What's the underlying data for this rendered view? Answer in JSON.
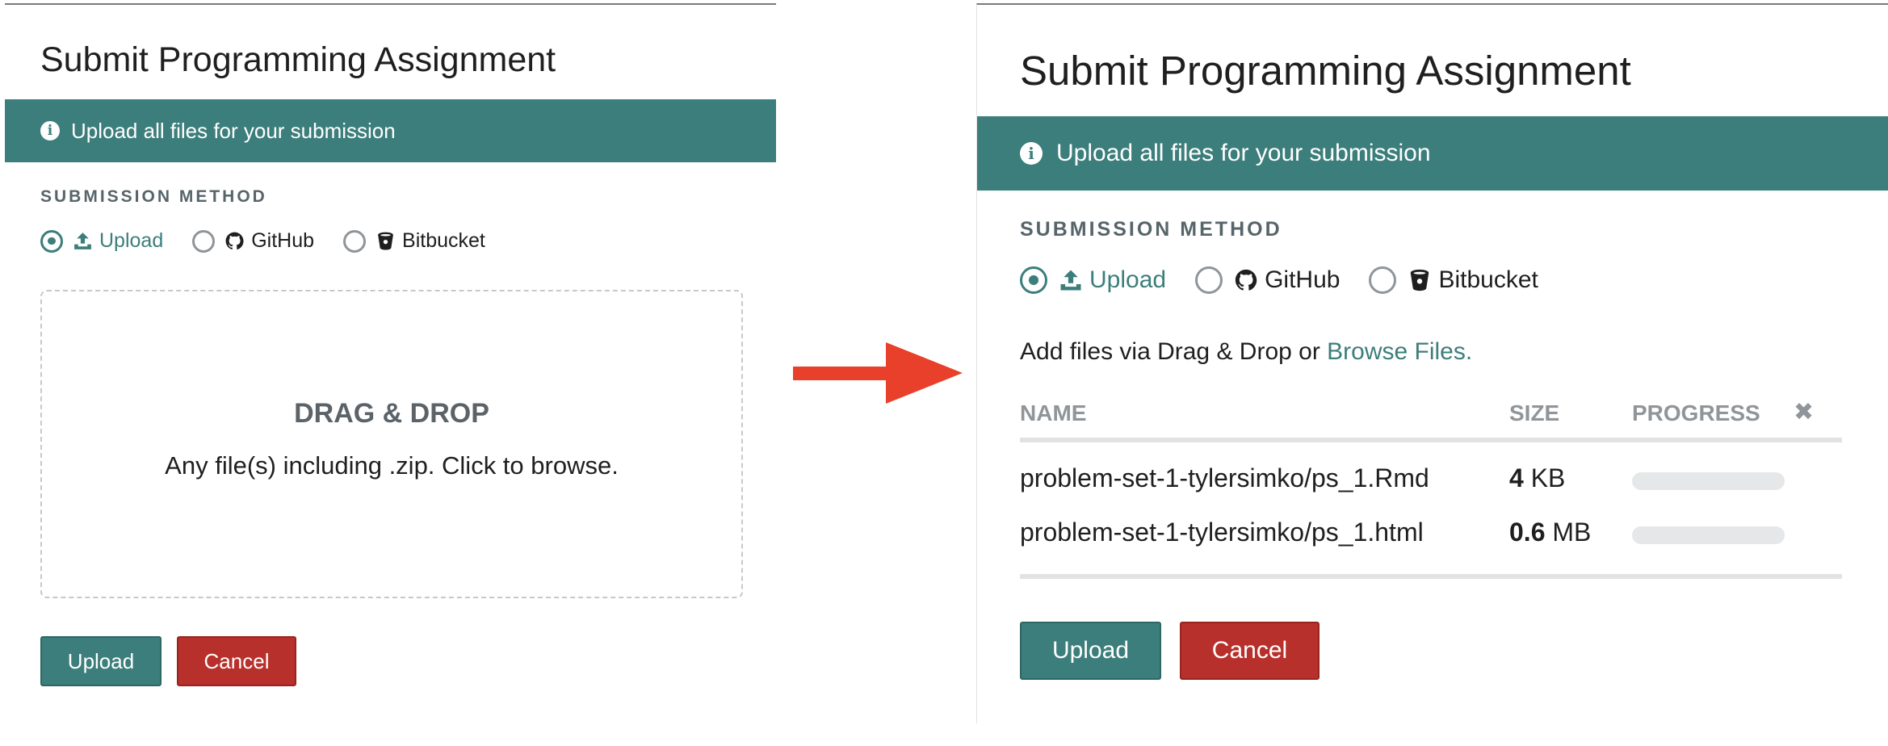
{
  "before": {
    "title": "Submit Programming Assignment",
    "banner_text": "Upload all files for your submission",
    "section_label": "SUBMISSION METHOD",
    "methods": [
      {
        "label": "Upload",
        "icon": "upload-icon",
        "selected": true
      },
      {
        "label": "GitHub",
        "icon": "github-icon",
        "selected": false
      },
      {
        "label": "Bitbucket",
        "icon": "bitbucket-icon",
        "selected": false
      }
    ],
    "dropzone": {
      "title": "DRAG & DROP",
      "subtitle": "Any file(s) including .zip. Click to browse."
    },
    "buttons": {
      "upload": "Upload",
      "cancel": "Cancel"
    }
  },
  "after": {
    "title": "Submit Programming Assignment",
    "banner_text": "Upload all files for your submission",
    "section_label": "SUBMISSION METHOD",
    "methods": [
      {
        "label": "Upload",
        "icon": "upload-icon",
        "selected": true
      },
      {
        "label": "GitHub",
        "icon": "github-icon",
        "selected": false
      },
      {
        "label": "Bitbucket",
        "icon": "bitbucket-icon",
        "selected": false
      }
    ],
    "add_files": {
      "text": "Add files via Drag & Drop or ",
      "link": "Browse Files."
    },
    "table": {
      "headers": {
        "name": "NAME",
        "size": "SIZE",
        "progress": "PROGRESS"
      },
      "clear_icon": "close-icon",
      "files": [
        {
          "name": "problem-set-1-tylersimko/ps_1.Rmd",
          "size_value": "4",
          "size_unit": "KB",
          "progress": 0
        },
        {
          "name": "problem-set-1-tylersimko/ps_1.html",
          "size_value": "0.6",
          "size_unit": "MB",
          "progress": 0
        }
      ]
    },
    "buttons": {
      "upload": "Upload",
      "cancel": "Cancel"
    }
  },
  "colors": {
    "accent": "#3c7e7b",
    "danger": "#b8302c",
    "arrow": "#e8402a",
    "muted_text": "#8f9599",
    "rule": "#e2e2e2"
  }
}
